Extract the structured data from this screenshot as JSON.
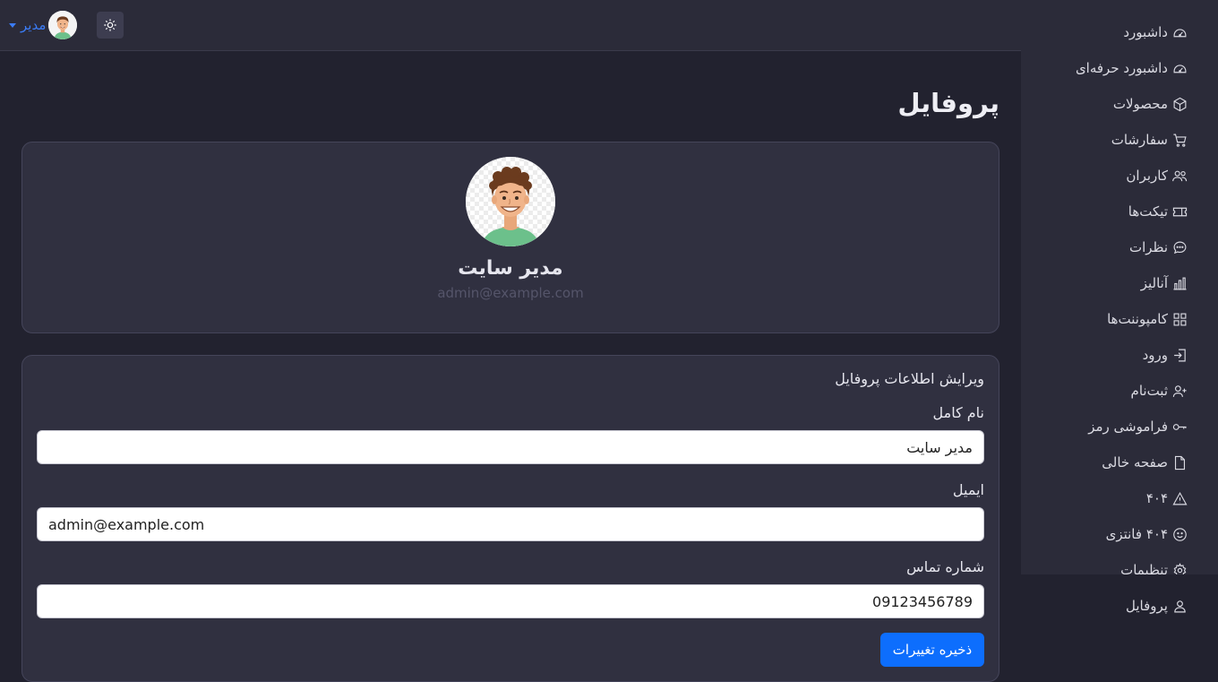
{
  "topbar": {
    "user_name": "مدیر",
    "theme_toggle_icon": "sun-icon"
  },
  "sidebar": {
    "items": [
      {
        "label": "داشبورد",
        "icon": "speedometer-icon"
      },
      {
        "label": "داشبورد حرفه‌ای",
        "icon": "speedometer-icon"
      },
      {
        "label": "محصولات",
        "icon": "box-icon"
      },
      {
        "label": "سفارشات",
        "icon": "cart-icon"
      },
      {
        "label": "کاربران",
        "icon": "users-icon"
      },
      {
        "label": "تیکت‌ها",
        "icon": "ticket-icon"
      },
      {
        "label": "نظرات",
        "icon": "chat-icon"
      },
      {
        "label": "آنالیز",
        "icon": "bar-chart-icon"
      },
      {
        "label": "کامپوننت‌ها",
        "icon": "grid-icon"
      },
      {
        "label": "ورود",
        "icon": "login-icon"
      },
      {
        "label": "ثبت‌نام",
        "icon": "user-plus-icon"
      },
      {
        "label": "فراموشی رمز",
        "icon": "key-icon"
      },
      {
        "label": "صفحه خالی",
        "icon": "file-icon"
      },
      {
        "label": "۴۰۴",
        "icon": "warning-icon"
      },
      {
        "label": "۴۰۴ فانتزی",
        "icon": "smile-icon"
      },
      {
        "label": "تنظیمات",
        "icon": "gear-icon"
      },
      {
        "label": "پروفایل",
        "icon": "person-icon"
      }
    ]
  },
  "main": {
    "page_title": "پروفایل",
    "profile": {
      "name": "مدیر سایت",
      "email": "admin@example.com"
    },
    "form": {
      "title": "ویرایش اطلاعات پروفایل",
      "full_name_label": "نام کامل",
      "full_name_value": "مدیر سایت",
      "email_label": "ایمیل",
      "email_value": "admin@example.com",
      "phone_label": "شماره تماس",
      "phone_value": "09123456789",
      "save_label": "ذخیره تغییرات"
    }
  },
  "colors": {
    "accent": "#0d6efd",
    "user_link": "#3b7cf6",
    "background": "#22222f",
    "panel": "#2b2b39",
    "card": "#303040"
  }
}
